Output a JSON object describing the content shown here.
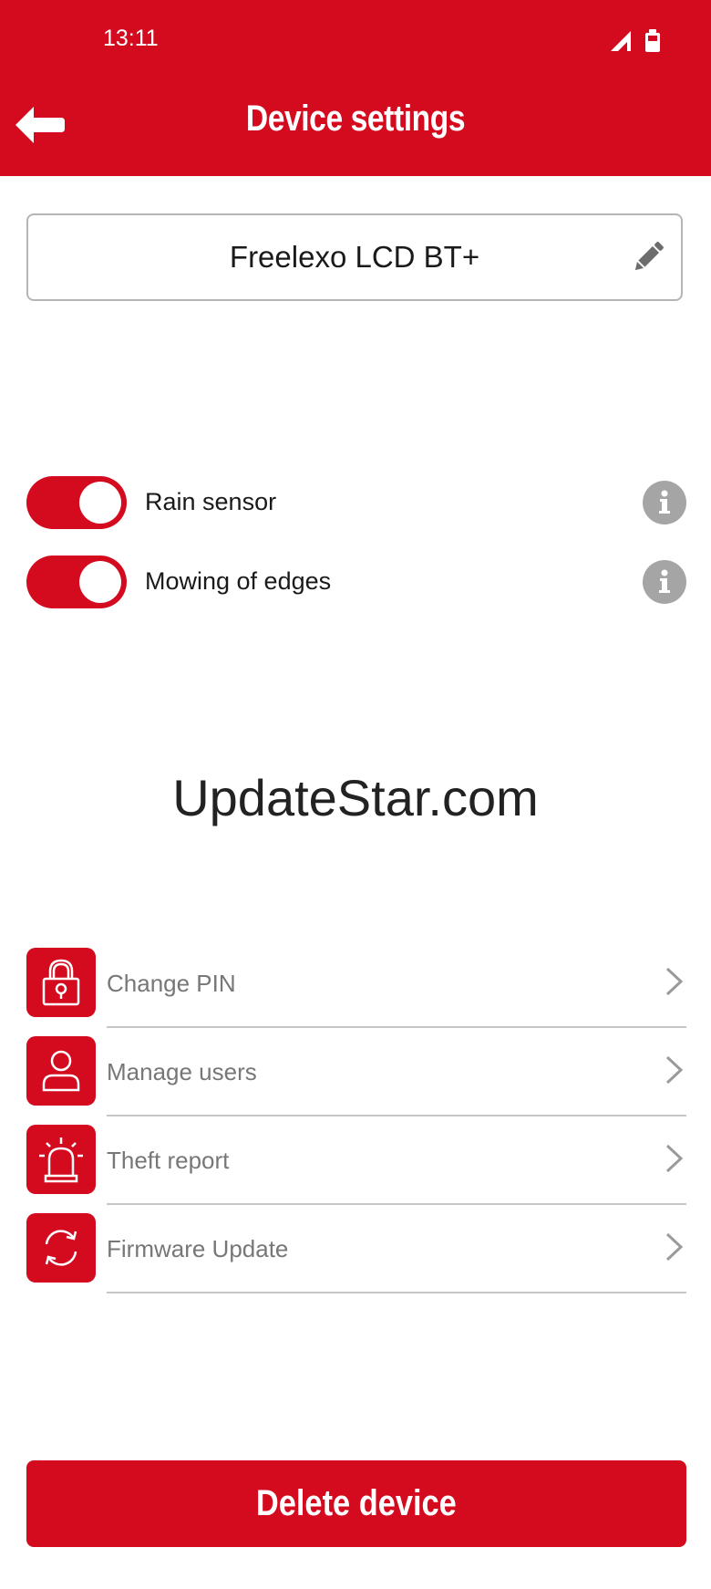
{
  "status_bar": {
    "time": "13:11"
  },
  "header": {
    "title": "Device settings"
  },
  "device": {
    "name": "Freelexo LCD BT+"
  },
  "toggles": [
    {
      "label": "Rain sensor",
      "state": "on"
    },
    {
      "label": "Mowing of edges",
      "state": "on"
    }
  ],
  "watermark": {
    "text": "UpdateStar.com"
  },
  "menu": {
    "items": [
      {
        "label": "Change PIN",
        "icon": "lock-icon"
      },
      {
        "label": "Manage users",
        "icon": "user-icon"
      },
      {
        "label": "Theft report",
        "icon": "siren-icon"
      },
      {
        "label": "Firmware Update",
        "icon": "refresh-icon"
      }
    ]
  },
  "footer": {
    "delete_label": "Delete device"
  },
  "colors": {
    "accent": "#d40b1f",
    "info_gray": "#a5a5a5",
    "menu_text": "#777777"
  }
}
